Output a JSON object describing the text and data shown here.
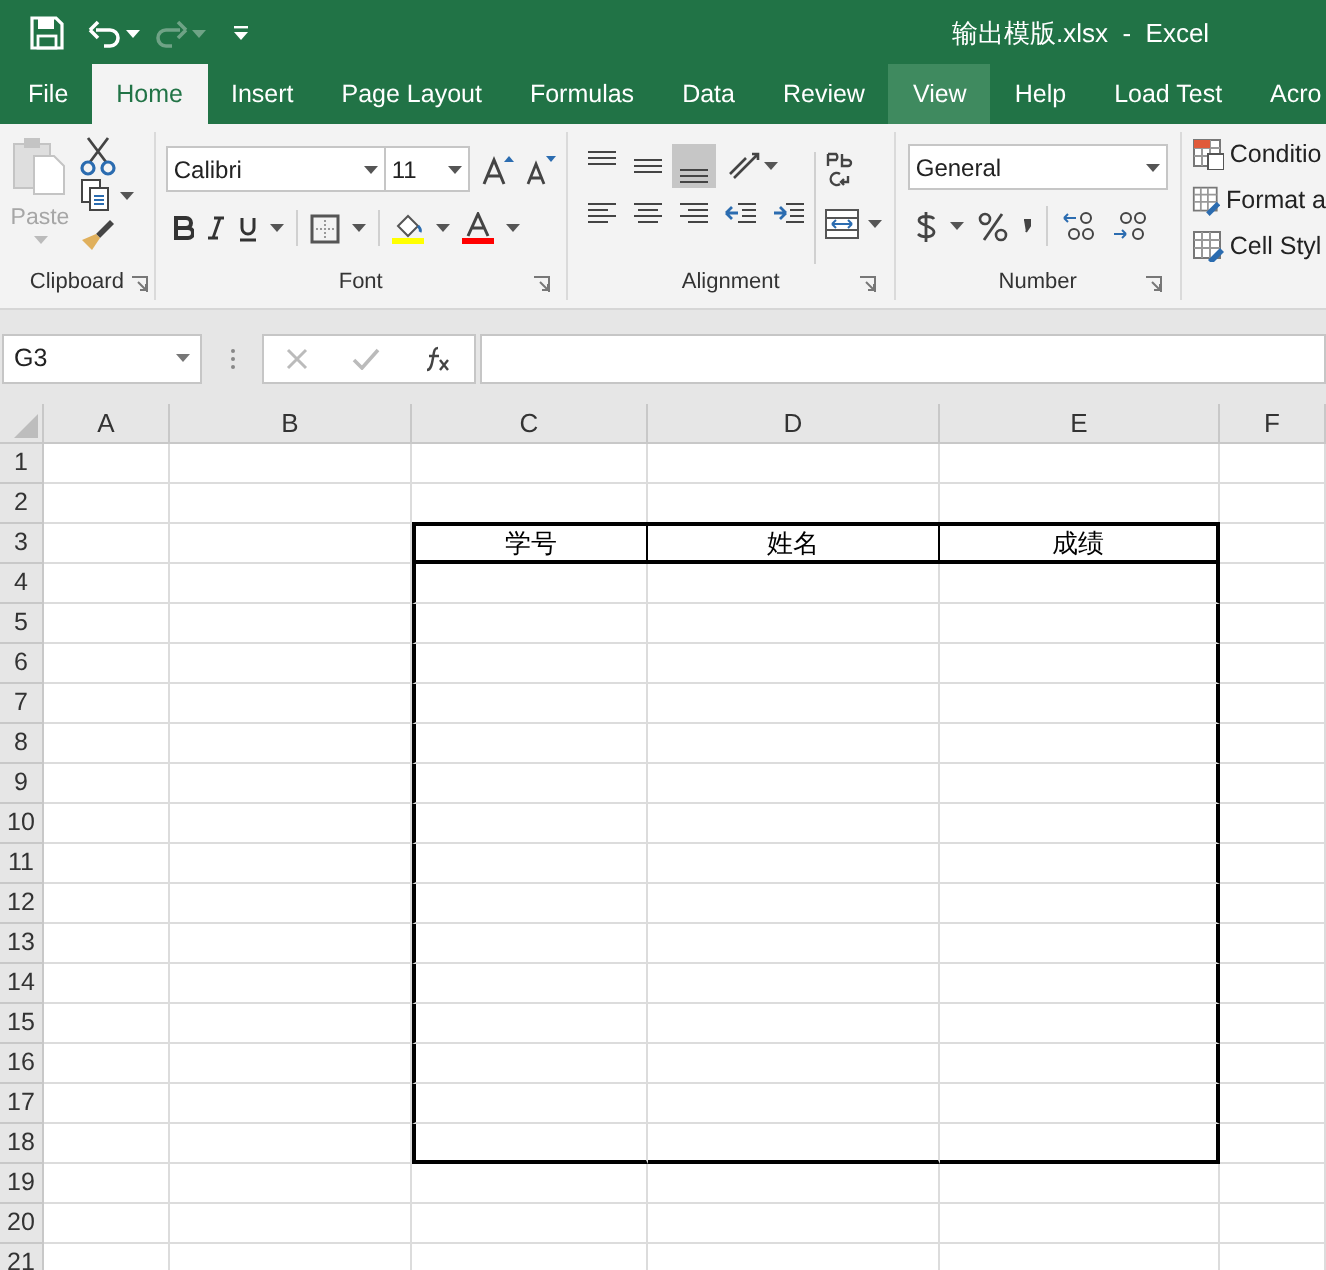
{
  "window": {
    "title": "输出模版.xlsx  -  Excel"
  },
  "quick_access": {
    "redo": {
      "disabled": true
    }
  },
  "tabs": [
    {
      "label": "File",
      "selected": false,
      "hover": false
    },
    {
      "label": "Home",
      "selected": true,
      "hover": false
    },
    {
      "label": "Insert",
      "selected": false,
      "hover": false
    },
    {
      "label": "Page Layout",
      "selected": false,
      "hover": false
    },
    {
      "label": "Formulas",
      "selected": false,
      "hover": false
    },
    {
      "label": "Data",
      "selected": false,
      "hover": false
    },
    {
      "label": "Review",
      "selected": false,
      "hover": false
    },
    {
      "label": "View",
      "selected": false,
      "hover": true
    },
    {
      "label": "Help",
      "selected": false,
      "hover": false
    },
    {
      "label": "Load Test",
      "selected": false,
      "hover": false
    },
    {
      "label": "Acro",
      "selected": false,
      "hover": false
    }
  ],
  "ribbon": {
    "clipboard": {
      "paste": {
        "label": "Paste",
        "disabled": true
      },
      "group_label": "Clipboard"
    },
    "font": {
      "font_name": "Calibri",
      "font_size": "11",
      "group_label": "Font"
    },
    "alignment": {
      "vertical_buttons": [
        {
          "selected": false
        },
        {
          "selected": false
        },
        {
          "selected": true
        }
      ],
      "group_label": "Alignment"
    },
    "number": {
      "format": "General",
      "group_label": "Number"
    },
    "styles": {
      "items": [
        "Conditio",
        "Format a",
        "Cell Styl"
      ]
    }
  },
  "formula_bar": {
    "name_box": "G3"
  },
  "sheet": {
    "columns": [
      "A",
      "B",
      "C",
      "D",
      "E",
      "F"
    ],
    "rows": [
      {
        "label": "1",
        "framed": false,
        "header": false
      },
      {
        "label": "2",
        "framed": false,
        "header": false
      },
      {
        "label": "3",
        "values": [
          "学号",
          "姓名",
          "成绩"
        ],
        "framed": true,
        "header": true
      },
      {
        "label": "4",
        "framed": true,
        "header": false
      },
      {
        "label": "5",
        "framed": true,
        "header": false
      },
      {
        "label": "6",
        "framed": true,
        "header": false
      },
      {
        "label": "7",
        "framed": true,
        "header": false
      },
      {
        "label": "8",
        "framed": true,
        "header": false
      },
      {
        "label": "9",
        "framed": true,
        "header": false
      },
      {
        "label": "10",
        "framed": true,
        "header": false
      },
      {
        "label": "11",
        "framed": true,
        "header": false
      },
      {
        "label": "12",
        "framed": true,
        "header": false
      },
      {
        "label": "13",
        "framed": true,
        "header": false
      },
      {
        "label": "14",
        "framed": true,
        "header": false
      },
      {
        "label": "15",
        "framed": true,
        "header": false
      },
      {
        "label": "16",
        "framed": true,
        "header": false
      },
      {
        "label": "17",
        "framed": true,
        "header": false
      },
      {
        "label": "18",
        "framed": true,
        "header": false
      },
      {
        "label": "19",
        "framed": false,
        "header": false
      },
      {
        "label": "20",
        "framed": false,
        "header": false
      },
      {
        "label": "21",
        "framed": false,
        "header": false
      }
    ]
  }
}
